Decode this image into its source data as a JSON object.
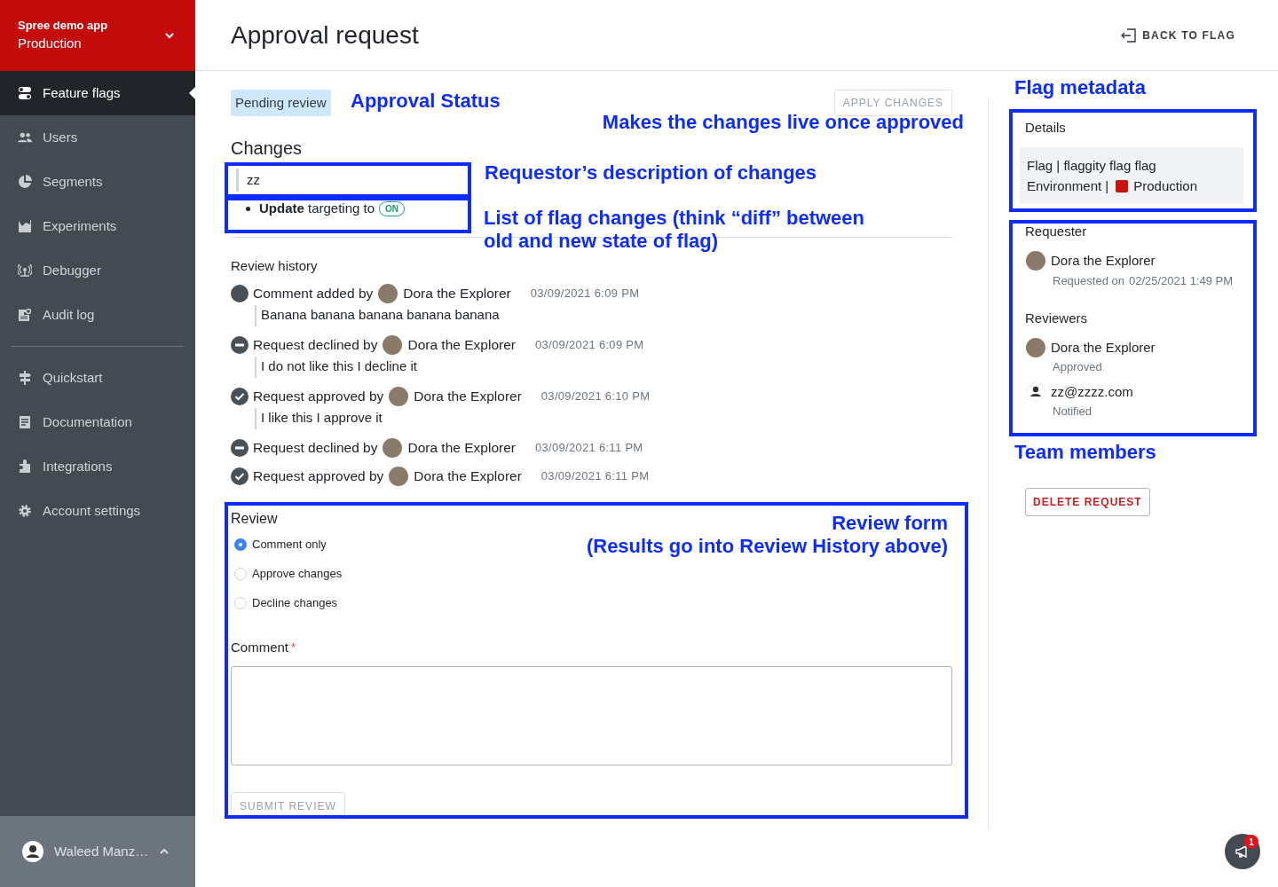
{
  "sidebar": {
    "app": {
      "name": "Spree demo app",
      "environment": "Production"
    },
    "sections": [
      {
        "items": [
          {
            "label": "Feature flags",
            "selected": true
          },
          {
            "label": "Users",
            "selected": false
          },
          {
            "label": "Segments",
            "selected": false
          },
          {
            "label": "Experiments",
            "selected": false
          },
          {
            "label": "Debugger",
            "selected": false
          },
          {
            "label": "Audit log",
            "selected": false
          }
        ]
      },
      {
        "items": [
          {
            "label": "Quickstart",
            "selected": false
          },
          {
            "label": "Documentation",
            "selected": false
          },
          {
            "label": "Integrations",
            "selected": false
          },
          {
            "label": "Account settings",
            "selected": false
          }
        ]
      }
    ],
    "user": {
      "name": "Waleed Manz…"
    }
  },
  "header": {
    "title": "Approval request",
    "back_link": "BACK TO FLAG"
  },
  "status": {
    "badge": "Pending review",
    "apply_button": {
      "label": "APPLY CHANGES",
      "disabled": true
    }
  },
  "changes": {
    "title": "Changes",
    "description": "zz",
    "items": [
      {
        "text": "**Update** targeting to",
        "badge": "ON"
      }
    ]
  },
  "review_history": {
    "title": "Review history",
    "entries": [
      {
        "kind": "comment",
        "text": "Comment added by",
        "user": "Dora the Explorer",
        "time": "03/09/2021 6:09 PM",
        "comment": "Banana banana banana banana banana"
      },
      {
        "kind": "declined",
        "text": "Request declined by",
        "user": "Dora the Explorer",
        "time": "03/09/2021 6:09 PM",
        "comment": "I do not like this I decline it"
      },
      {
        "kind": "approved",
        "text": "Request approved by",
        "user": "Dora the Explorer",
        "time": "03/09/2021 6:10 PM",
        "comment": "I like this I approve it"
      },
      {
        "kind": "declined",
        "text": "Request declined by",
        "user": "Dora the Explorer",
        "time": "03/09/2021 6:11 PM"
      },
      {
        "kind": "approved",
        "text": "Request approved by",
        "user": "Dora the Explorer",
        "time": "03/09/2021 6:11 PM"
      }
    ]
  },
  "review_form": {
    "title": "Review",
    "options": [
      {
        "label": "Comment only",
        "selected": true
      },
      {
        "label": "Approve changes",
        "selected": false
      },
      {
        "label": "Decline changes",
        "selected": false
      }
    ],
    "comment": {
      "label": "Comment",
      "required_mark": "*"
    },
    "submit_button": {
      "label": "SUBMIT REVIEW",
      "disabled": true
    }
  },
  "details": {
    "title": "Details",
    "flag": "Flag | flaggity flag flag",
    "environment_label": "Environment |",
    "environment": {
      "name": "Production",
      "color": "#cc1111"
    }
  },
  "requester": {
    "title": "Requester",
    "name": "Dora the Explorer",
    "requested_label": "Requested on",
    "requested_time": "02/25/2021 1:49 PM"
  },
  "reviewers": {
    "title": "Reviewers",
    "items": [
      {
        "kind": "avatar",
        "name": "Dora the Explorer",
        "status": "Approved"
      },
      {
        "kind": "generic",
        "name": "zz@zzzz.com",
        "status": "Notified"
      }
    ]
  },
  "delete_button": "DELETE REQUEST",
  "notifications": {
    "count": "1"
  },
  "annotations": [
    {
      "lines": [
        "Approval Status"
      ]
    },
    {
      "lines": [
        "Makes the changes live once approved"
      ]
    },
    {
      "lines": [
        "Requestor’s description of changes"
      ]
    },
    {
      "lines": [
        "List of flag changes (think “diff” between",
        "old and new state of flag)"
      ]
    },
    {
      "lines": [
        "Flag metadata"
      ]
    },
    {
      "lines": [
        "Team members"
      ]
    },
    {
      "lines": [
        "Review form",
        "(Results go into Review History above)"
      ]
    }
  ]
}
